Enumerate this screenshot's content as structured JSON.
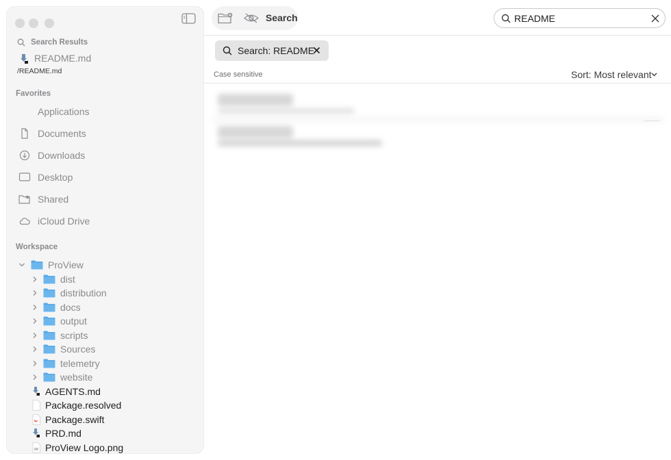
{
  "toolbar": {
    "title": "Search"
  },
  "search": {
    "value": "README"
  },
  "sidebar": {
    "search_results": {
      "label": "Search Results",
      "item": {
        "name": "README.md",
        "path": "/README.md"
      }
    },
    "favorites": {
      "label": "Favorites",
      "items": [
        {
          "label": "Applications",
          "icon": "none"
        },
        {
          "label": "Documents",
          "icon": "document-icon"
        },
        {
          "label": "Downloads",
          "icon": "download-icon"
        },
        {
          "label": "Desktop",
          "icon": "desktop-icon"
        },
        {
          "label": "Shared",
          "icon": "shared-folder-icon"
        },
        {
          "label": "iCloud Drive",
          "icon": "cloud-icon"
        }
      ]
    },
    "workspace": {
      "label": "Workspace",
      "root": "ProView",
      "folders": [
        "dist",
        "distribution",
        "docs",
        "output",
        "scripts",
        "Sources",
        "telemetry",
        "website"
      ],
      "files": [
        "AGENTS.md",
        "Package.resolved",
        "Package.swift",
        "PRD.md",
        "ProView Logo.png"
      ]
    }
  },
  "filter_chip": {
    "label": "Search: README"
  },
  "options": {
    "case_label": "Case sensitive",
    "sort_label": "Sort: Most relevant"
  },
  "colors": {
    "folder": "#5aa9e6",
    "sidebar_bg": "#f5f5f5",
    "chip_bg": "#e4e4e4"
  }
}
